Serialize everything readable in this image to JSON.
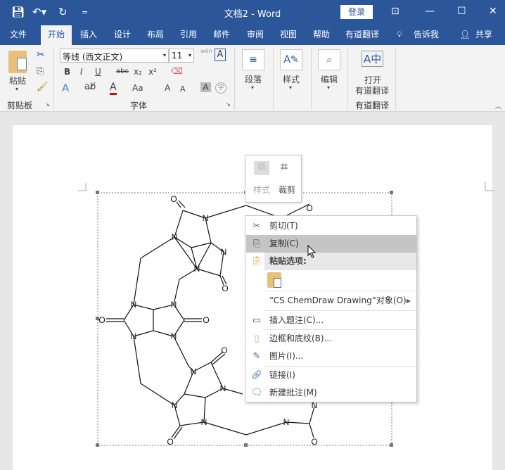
{
  "titlebar": {
    "title": "文档2  -  Word",
    "login": "登录",
    "quick_access_more": "="
  },
  "tabs": [
    {
      "label": "文件"
    },
    {
      "label": "开始",
      "active": true
    },
    {
      "label": "插入"
    },
    {
      "label": "设计"
    },
    {
      "label": "布局"
    },
    {
      "label": "引用"
    },
    {
      "label": "邮件"
    },
    {
      "label": "审阅"
    },
    {
      "label": "视图"
    },
    {
      "label": "帮助"
    },
    {
      "label": "有道翻译"
    },
    {
      "label": "告诉我"
    },
    {
      "label": "共享"
    }
  ],
  "ribbon": {
    "clipboard": {
      "paste": "粘贴",
      "group": "剪贴板"
    },
    "font": {
      "name": "等线 (西文正文)",
      "size": "11",
      "bold": "B",
      "italic": "I",
      "underline": "U",
      "strike": "abc",
      "sub": "x₂",
      "sup": "x²",
      "text_effect": "A",
      "font_color": "A",
      "case": "Aa",
      "grow": "A",
      "shrink": "A",
      "shade": "A",
      "enclose": "字",
      "phonetic": "wén",
      "border": "A",
      "group": "字体"
    },
    "paragraph": {
      "label": "段落"
    },
    "styles": {
      "label": "样式"
    },
    "editing": {
      "label": "编辑"
    },
    "youdao": {
      "line1": "打开",
      "line2": "有道翻译",
      "group": "有道翻译"
    }
  },
  "minibar": {
    "style": "样式",
    "crop": "裁剪"
  },
  "context_menu": {
    "items": [
      {
        "label": "剪切(T)",
        "icon": "scissors-icon"
      },
      {
        "label": "复制(C)",
        "icon": "copy-icon",
        "hover": true
      },
      {
        "label": "粘贴选项:",
        "icon": "paste-icon",
        "header": true
      },
      {
        "label": "“CS ChemDraw Drawing”对象(O)",
        "submenu": true
      },
      {
        "label": "插入题注(C)...",
        "icon": "caption-icon"
      },
      {
        "label": "边框和底纹(B)...",
        "icon": "border-icon"
      },
      {
        "label": "图片(I)...",
        "icon": "picture-icon"
      },
      {
        "label": "链接(I)",
        "icon": "link-icon"
      },
      {
        "label": "新建批注(M)",
        "icon": "comment-icon"
      }
    ]
  },
  "molecule": {
    "atom_labels": [
      "O",
      "N"
    ]
  },
  "colors": {
    "brand": "#2b579a",
    "hover": "#c5c5c5",
    "paste_header": "#e8e8e8"
  }
}
